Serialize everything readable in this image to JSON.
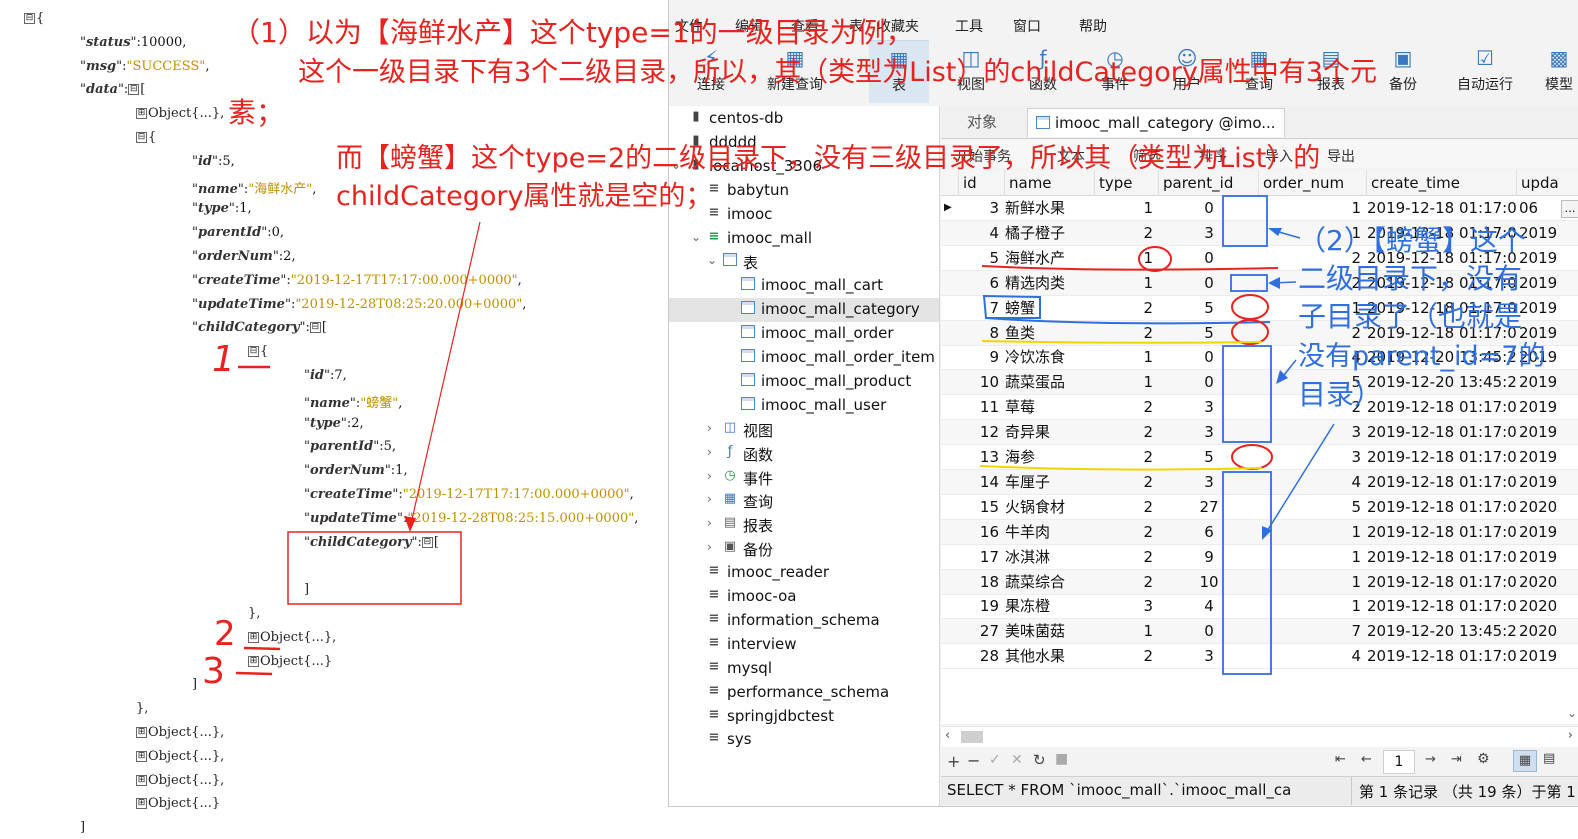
{
  "json_tree": {
    "lines": [
      {
        "indent": 0,
        "toggle": "⊟",
        "text": "{"
      },
      {
        "indent": 1,
        "key": "status",
        "value": "10000",
        "kind": "num",
        "tail": ","
      },
      {
        "indent": 1,
        "key": "msg",
        "value": "\"SUCCESS\"",
        "kind": "str",
        "tail": ","
      },
      {
        "indent": 1,
        "key": "data",
        "toggle": "⊟",
        "text": "["
      },
      {
        "indent": 2,
        "toggle": "⊞",
        "text": "Object{...},"
      },
      {
        "indent": 2,
        "toggle": "⊟",
        "text": "{"
      },
      {
        "indent": 3,
        "key": "id",
        "value": "5",
        "kind": "num",
        "tail": ","
      },
      {
        "indent": 3,
        "key": "name",
        "value": "\"海鲜水产\"",
        "kind": "str",
        "tail": ","
      },
      {
        "indent": 3,
        "key": "type",
        "value": "1",
        "kind": "num",
        "tail": ","
      },
      {
        "indent": 3,
        "key": "parentId",
        "value": "0",
        "kind": "num",
        "tail": ","
      },
      {
        "indent": 3,
        "key": "orderNum",
        "value": "2",
        "kind": "num",
        "tail": ","
      },
      {
        "indent": 3,
        "key": "createTime",
        "value": "\"2019-12-17T17:17:00.000+0000\"",
        "kind": "str",
        "tail": ","
      },
      {
        "indent": 3,
        "key": "updateTime",
        "value": "\"2019-12-28T08:25:20.000+0000\"",
        "kind": "str",
        "tail": ","
      },
      {
        "indent": 3,
        "key": "childCategory",
        "toggle": "⊟",
        "text": "["
      },
      {
        "indent": 4,
        "toggle": "⊟",
        "text": "{"
      },
      {
        "indent": 5,
        "key": "id",
        "value": "7",
        "kind": "num",
        "tail": ","
      },
      {
        "indent": 5,
        "key": "name",
        "value": "\"螃蟹\"",
        "kind": "str",
        "tail": ","
      },
      {
        "indent": 5,
        "key": "type",
        "value": "2",
        "kind": "num",
        "tail": ","
      },
      {
        "indent": 5,
        "key": "parentId",
        "value": "5",
        "kind": "num",
        "tail": ","
      },
      {
        "indent": 5,
        "key": "orderNum",
        "value": "1",
        "kind": "num",
        "tail": ","
      },
      {
        "indent": 5,
        "key": "createTime",
        "value": "\"2019-12-17T17:17:00.000+0000\"",
        "kind": "str",
        "tail": ","
      },
      {
        "indent": 5,
        "key": "updateTime",
        "value": "\"2019-12-28T08:25:15.000+0000\"",
        "kind": "str",
        "tail": ","
      },
      {
        "indent": 5,
        "key": "childCategory",
        "toggle": "⊟",
        "text": "["
      },
      {
        "indent": 5,
        "text": ""
      },
      {
        "indent": 5,
        "text": "]"
      },
      {
        "indent": 4,
        "text": "},"
      },
      {
        "indent": 4,
        "toggle": "⊞",
        "text": "Object{...},"
      },
      {
        "indent": 4,
        "toggle": "⊞",
        "text": "Object{...}"
      },
      {
        "indent": 3,
        "text": "]"
      },
      {
        "indent": 2,
        "text": "},"
      },
      {
        "indent": 2,
        "toggle": "⊞",
        "text": "Object{...},"
      },
      {
        "indent": 2,
        "toggle": "⊞",
        "text": "Object{...},"
      },
      {
        "indent": 2,
        "toggle": "⊞",
        "text": "Object{...},"
      },
      {
        "indent": 2,
        "toggle": "⊞",
        "text": "Object{...}"
      },
      {
        "indent": 1,
        "text": "]"
      }
    ]
  },
  "menubar": [
    "文件",
    "编辑",
    "查看",
    "表",
    "收藏夹",
    "工具",
    "窗口",
    "帮助"
  ],
  "toolbar": [
    {
      "label": "连接",
      "icon": "connect-icon"
    },
    {
      "label": "新建查询",
      "icon": "new-query-icon"
    },
    {
      "label": "表",
      "icon": "table-icon",
      "active": true
    },
    {
      "label": "视图",
      "icon": "view-icon"
    },
    {
      "label": "函数",
      "icon": "function-icon"
    },
    {
      "label": "事件",
      "icon": "event-icon"
    },
    {
      "label": "用户",
      "icon": "user-icon"
    },
    {
      "label": "查询",
      "icon": "query-icon"
    },
    {
      "label": "报表",
      "icon": "report-icon"
    },
    {
      "label": "备份",
      "icon": "backup-icon"
    },
    {
      "label": "自动运行",
      "icon": "automation-icon"
    },
    {
      "label": "模型",
      "icon": "model-icon"
    }
  ],
  "nav_tree": [
    {
      "level": 0,
      "label": "centos-db",
      "icon": "server"
    },
    {
      "level": 0,
      "label": "ddddd",
      "icon": "server"
    },
    {
      "level": 0,
      "label": "localhost_3306",
      "icon": "server",
      "expanded": true
    },
    {
      "level": 1,
      "label": "babytun",
      "icon": "db"
    },
    {
      "level": 1,
      "label": "imooc",
      "icon": "db"
    },
    {
      "level": 1,
      "label": "imooc_mall",
      "icon": "db-open",
      "expanded": true
    },
    {
      "level": 2,
      "label": "表",
      "icon": "tables",
      "expanded": true
    },
    {
      "level": 3,
      "label": "imooc_mall_cart",
      "icon": "table"
    },
    {
      "level": 3,
      "label": "imooc_mall_category",
      "icon": "table",
      "selected": true
    },
    {
      "level": 3,
      "label": "imooc_mall_order",
      "icon": "table"
    },
    {
      "level": 3,
      "label": "imooc_mall_order_item",
      "icon": "table"
    },
    {
      "level": 3,
      "label": "imooc_mall_product",
      "icon": "table"
    },
    {
      "level": 3,
      "label": "imooc_mall_user",
      "icon": "table"
    },
    {
      "level": 2,
      "label": "视图",
      "icon": "views",
      "collapsed": true
    },
    {
      "level": 2,
      "label": "函数",
      "icon": "functions",
      "collapsed": true
    },
    {
      "level": 2,
      "label": "事件",
      "icon": "events",
      "collapsed": true
    },
    {
      "level": 2,
      "label": "查询",
      "icon": "queries",
      "collapsed": true
    },
    {
      "level": 2,
      "label": "报表",
      "icon": "reports",
      "collapsed": true
    },
    {
      "level": 2,
      "label": "备份",
      "icon": "backups",
      "collapsed": true
    },
    {
      "level": 1,
      "label": "imooc_reader",
      "icon": "db"
    },
    {
      "level": 1,
      "label": "imooc-oa",
      "icon": "db"
    },
    {
      "level": 1,
      "label": "information_schema",
      "icon": "db"
    },
    {
      "level": 1,
      "label": "interview",
      "icon": "db"
    },
    {
      "level": 1,
      "label": "mysql",
      "icon": "db"
    },
    {
      "level": 1,
      "label": "performance_schema",
      "icon": "db"
    },
    {
      "level": 1,
      "label": "springjdbctest",
      "icon": "db"
    },
    {
      "level": 1,
      "label": "sys",
      "icon": "db"
    }
  ],
  "tabs": [
    {
      "label": "对象",
      "active": false
    },
    {
      "label": "imooc_mall_category @imo...",
      "active": true
    }
  ],
  "subtoolbar": [
    "开始事务",
    "文本",
    "筛选",
    "排序",
    "导入",
    "导出"
  ],
  "grid": {
    "columns": [
      "id",
      "name",
      "type",
      "parent_id",
      "order_num",
      "create_time",
      "upda"
    ],
    "rows": [
      [
        "3",
        "新鲜水果",
        "1",
        "0",
        "1",
        "2019-12-18 01:17:0",
        "06"
      ],
      [
        "4",
        "橘子橙子",
        "2",
        "3",
        "1",
        "2019-12-18 01:17:0",
        "2019"
      ],
      [
        "5",
        "海鲜水产",
        "1",
        "0",
        "2",
        "2019-12-18 01:17:0",
        "2019"
      ],
      [
        "6",
        "精选肉类",
        "1",
        "0",
        "2",
        "2019-12-18 01:17:0",
        "2019"
      ],
      [
        "7",
        "螃蟹",
        "2",
        "5",
        "1",
        "2019-12-18 01:17:0",
        "2019"
      ],
      [
        "8",
        "鱼类",
        "2",
        "5",
        "2",
        "2019-12-18 01:17:0",
        "2019"
      ],
      [
        "9",
        "冷饮冻食",
        "1",
        "0",
        "4",
        "2019-12-20 13:45:28",
        "2019"
      ],
      [
        "10",
        "蔬菜蛋品",
        "1",
        "0",
        "5",
        "2019-12-20 13:45:28",
        "2019"
      ],
      [
        "11",
        "草莓",
        "2",
        "3",
        "2",
        "2019-12-18 01:17:0",
        "2019"
      ],
      [
        "12",
        "奇异果",
        "2",
        "3",
        "3",
        "2019-12-18 01:17:0",
        "2019"
      ],
      [
        "13",
        "海参",
        "2",
        "5",
        "3",
        "2019-12-18 01:17:0",
        "2019"
      ],
      [
        "14",
        "车厘子",
        "2",
        "3",
        "4",
        "2019-12-18 01:17:0",
        "2019"
      ],
      [
        "15",
        "火锅食材",
        "2",
        "27",
        "5",
        "2019-12-18 01:17:0",
        "2020"
      ],
      [
        "16",
        "牛羊肉",
        "2",
        "6",
        "1",
        "2019-12-18 01:17:0",
        "2019"
      ],
      [
        "17",
        "冰淇淋",
        "2",
        "9",
        "1",
        "2019-12-18 01:17:0",
        "2019"
      ],
      [
        "18",
        "蔬菜综合",
        "2",
        "10",
        "1",
        "2019-12-18 01:17:0",
        "2020"
      ],
      [
        "19",
        "果冻橙",
        "3",
        "4",
        "1",
        "2019-12-18 01:17:0",
        "2020"
      ],
      [
        "27",
        "美味菌菇",
        "1",
        "0",
        "7",
        "2019-12-20 13:45:28",
        "2020"
      ],
      [
        "28",
        "其他水果",
        "2",
        "3",
        "4",
        "2019-12-18 01:17:0",
        "2019"
      ]
    ]
  },
  "pager": {
    "page": "1"
  },
  "statusbar": {
    "sql": "SELECT * FROM `imooc_mall`.`imooc_mall_ca",
    "record_info": "第 1 条记录 （共 19 条）于第 1"
  },
  "annotations": {
    "note1_line1": "（1）以为【海鲜水产】这个type=1的一级目录为例，",
    "note1_line2": "这个一级目录下有3个二级目录，所以，其（类型为List）的childCategory属性中有3个元",
    "note1_line3": "素；",
    "note2_line1": "而【螃蟹】这个type=2的二级目录下，没有三级目录了，所以其（类型为List）的",
    "note2_line2": "childCategory属性就是空的；",
    "note3_line1": "（2）【螃蟹】这个",
    "note3_line2": "二级目录下，没有",
    "note3_line3": "子目录了（也就是",
    "note3_line4": "没有parent_id=7的",
    "note3_line5": "目录）",
    "mark1": "1",
    "mark2": "2",
    "mark3": "3",
    "red": "#e8231f",
    "blue": "#2f6fe0",
    "yellow": "#f2d600"
  }
}
